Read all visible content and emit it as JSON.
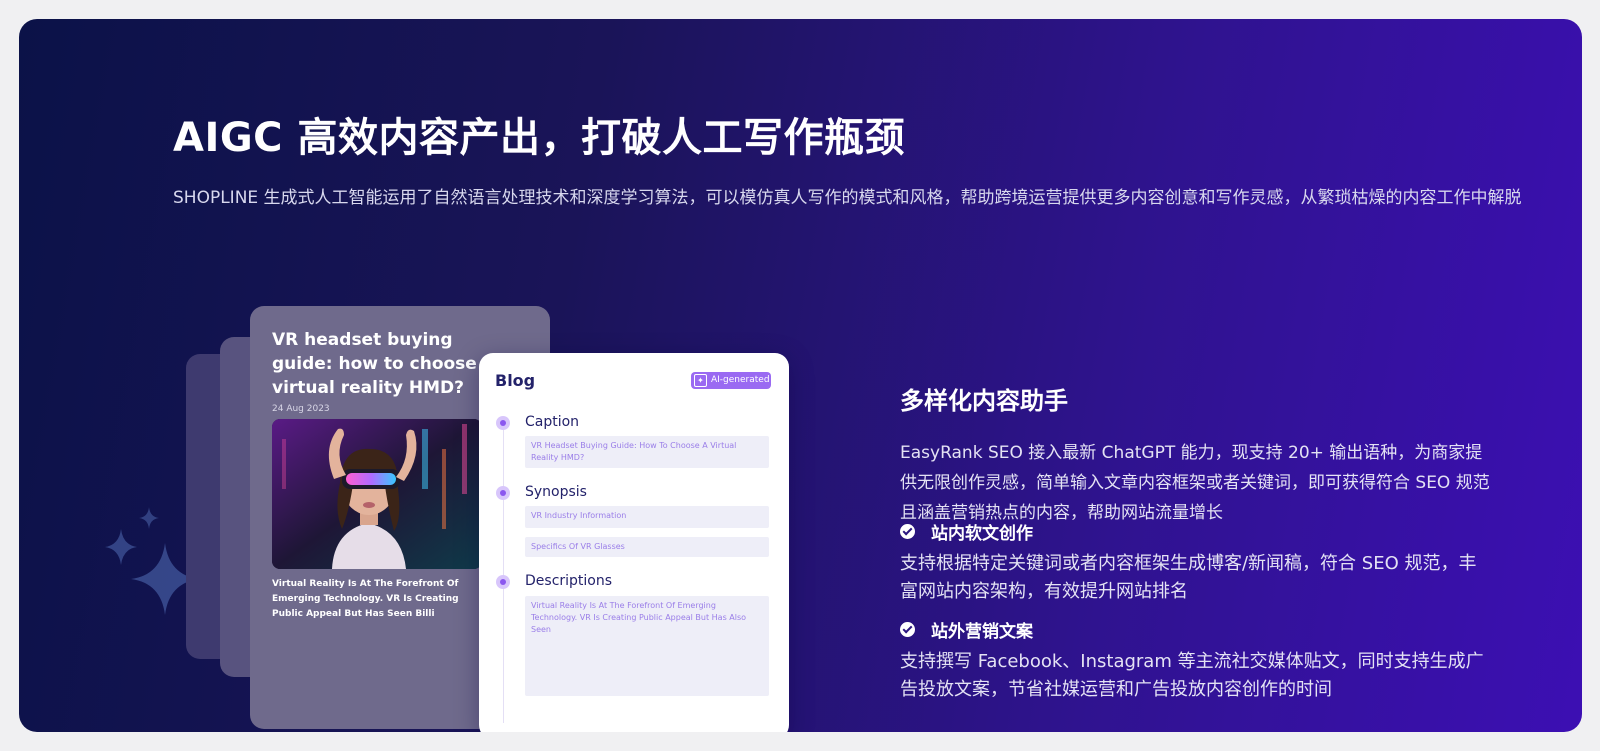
{
  "hero": {
    "title": "AIGC 高效内容产出，打破人工写作瓶颈",
    "subtitle": "SHOPLINE 生成式人工智能运用了自然语言处理技术和深度学习算法，可以模仿真人写作的模式和风格，帮助跨境运营提供更多内容创意和写作灵感，从繁琐枯燥的内容工作中解脱"
  },
  "article": {
    "title": "VR headset buying guide: how to choose a virtual reality HMD?",
    "date": "24 Aug 2023",
    "caption": "Virtual Reality Is At The Forefront Of Emerging Technology. VR Is Creating Public Appeal But Has Seen Billi",
    "image_icon": "vr-headset-photo"
  },
  "blog": {
    "title": "Blog",
    "badge": "AI-generated",
    "sections": {
      "caption": {
        "label": "Caption",
        "value": "VR Headset Buying Guide: How To Choose A Virtual Reality HMD?"
      },
      "synopsis": {
        "label": "Synopsis",
        "value1": "VR Industry Information",
        "value2": "Specifics Of VR Glasses"
      },
      "descriptions": {
        "label": "Descriptions",
        "value": "Virtual Reality Is At The Forefront Of Emerging Technology. VR Is Creating Public Appeal But Has Also Seen"
      }
    }
  },
  "features": {
    "title": "多样化内容助手",
    "description": "EasyRank SEO 接入最新 ChatGPT 能力，现支持 20+ 输出语种，为商家提供无限创作灵感，简单输入文章内容框架或者关键词，即可获得符合 SEO 规范且涵盖营销热点的内容，帮助网站流量增长",
    "items": [
      {
        "name": "站内软文创作",
        "text": "支持根据特定关键词或者内容框架生成博客/新闻稿，符合 SEO 规范，丰富网站内容架构，有效提升网站排名"
      },
      {
        "name": "站外营销文案",
        "text": "支持撰写 Facebook、Instagram 等主流社交媒体贴文，同时支持生成广告投放文案，节省社媒运营和广告投放内容创作的时间"
      }
    ]
  },
  "colors": {
    "bg_start": "#0b1248",
    "bg_end": "#3c0fb3",
    "accent": "#8b57ef",
    "badge": "#9a6af2"
  }
}
